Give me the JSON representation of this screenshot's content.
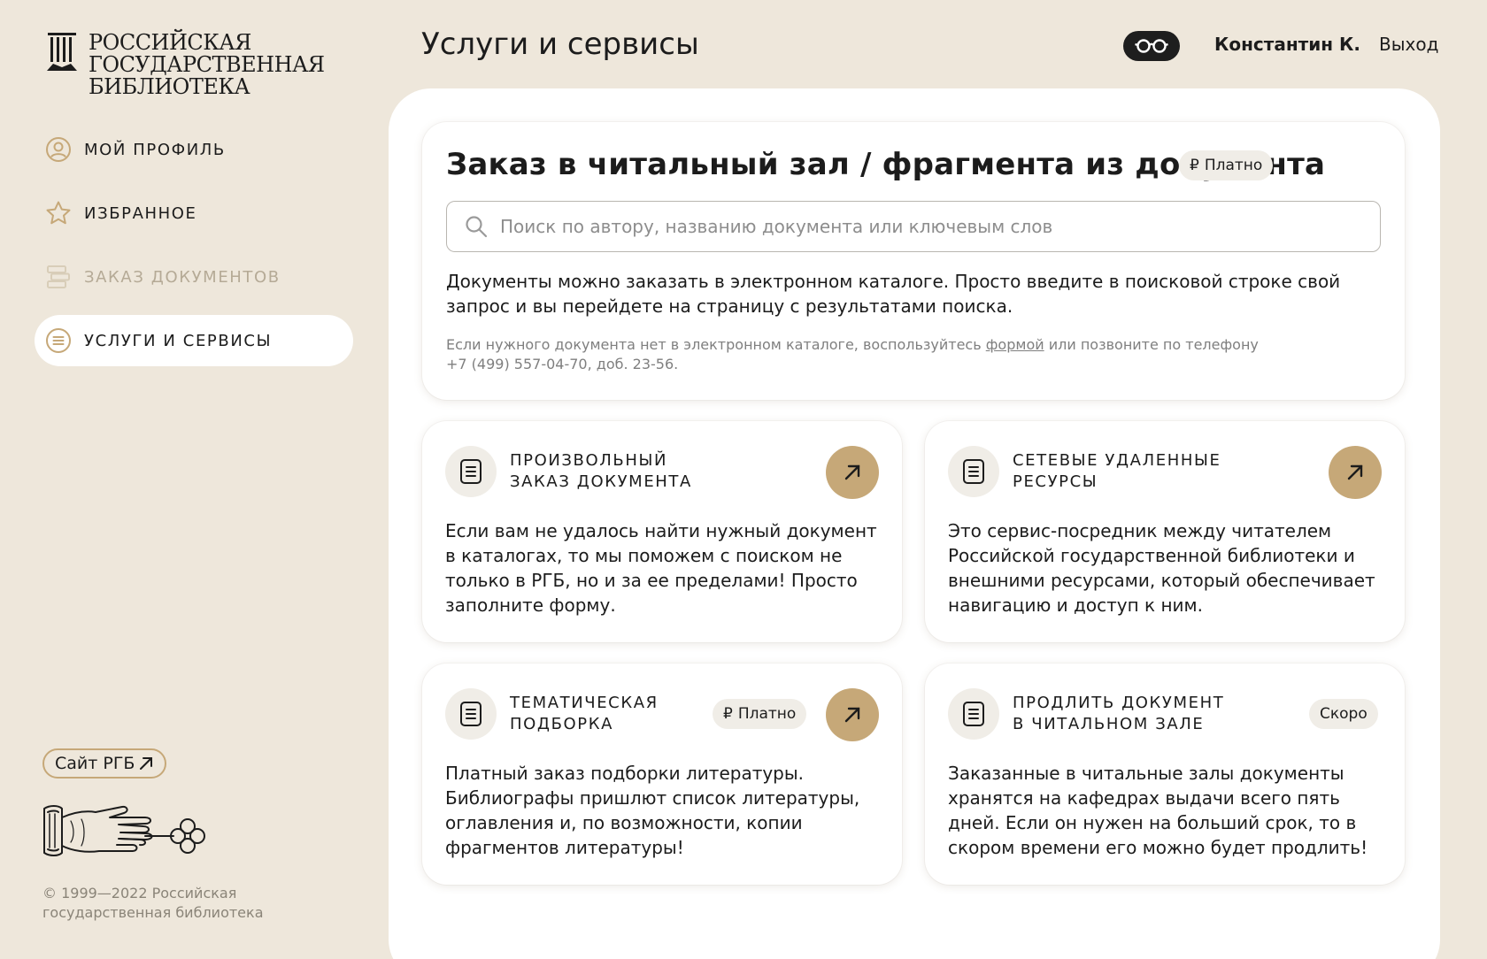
{
  "sidebar": {
    "logo_lines": [
      "Российская",
      "государственная",
      "библиотека"
    ],
    "nav": [
      {
        "label": "Мой профиль",
        "icon": "user-circle-icon",
        "state": "normal"
      },
      {
        "label": "Избранное",
        "icon": "star-icon",
        "state": "normal"
      },
      {
        "label": "Заказ документов",
        "icon": "documents-stack-icon",
        "state": "disabled"
      },
      {
        "label": "Услуги и сервисы",
        "icon": "list-circle-icon",
        "state": "active"
      }
    ],
    "site_link": "Сайт РГБ",
    "copyright_lines": [
      "© 1999—2022 Российская",
      "государственная библиотека"
    ]
  },
  "header": {
    "title": "Услуги и сервисы",
    "accessibility_icon": "glasses-icon",
    "user_name": "Константин К.",
    "logout": "Выход"
  },
  "main_card": {
    "title": "Заказ в читальный зал / фрагмента из документа",
    "badge": "Платно",
    "currency_symbol": "₽",
    "search_placeholder": "Поиск по автору, названию документа или ключевым слов",
    "description": "Документы можно заказать в электронном каталоге. Просто введите в поисковой строке свой запрос и вы перейдете на страницу с результатами поиска.",
    "note_before": "Если нужного документа нет в электронном каталоге, воспользуйтесь ",
    "note_link": "формой",
    "note_after_1": " или позвоните по телефону",
    "note_after_2": "+7 (499) 557-04-70, доб. 23-56."
  },
  "services": [
    {
      "title_lines": [
        "Произвольный",
        "заказ документа"
      ],
      "description": "Если вам не удалось найти нужный документ в каталогах, то мы поможем с поиском не только в РГБ, но и за ее пределами! Просто заполните форму.",
      "badge": "",
      "has_arrow": true
    },
    {
      "title_lines": [
        "Сетевые удаленные",
        "ресурсы"
      ],
      "description": "Это сервис-посредник между читателем Российской государственной библиотеки и внешними ресурсами, который обеспечивает навигацию и доступ к ним.",
      "badge": "",
      "has_arrow": true
    },
    {
      "title_lines": [
        "Тематическая",
        "подборка"
      ],
      "description": "Платный заказ подборки литературы. Библиографы пришлют список литературы, оглавления и, по возможности, копии фрагментов литературы!",
      "badge": "Платно",
      "has_arrow": true
    },
    {
      "title_lines": [
        "Продлить документ",
        "в читальном зале"
      ],
      "description": "Заказанные в читальные залы документы хранятся на кафедрах выдачи всего пять дней. Если он нужен на больший срок, то в скором времени его можно будет продлить!",
      "badge": "Скоро",
      "has_arrow": false
    }
  ],
  "colors": {
    "background": "#EEE7DB",
    "accent_gold": "#C6A878",
    "panel": "#FFFFFF",
    "badge_bg": "#F0EDE7",
    "text": "#1C1C1C",
    "muted_text": "#7F7F7F",
    "disabled_nav": "#B5AA96"
  }
}
